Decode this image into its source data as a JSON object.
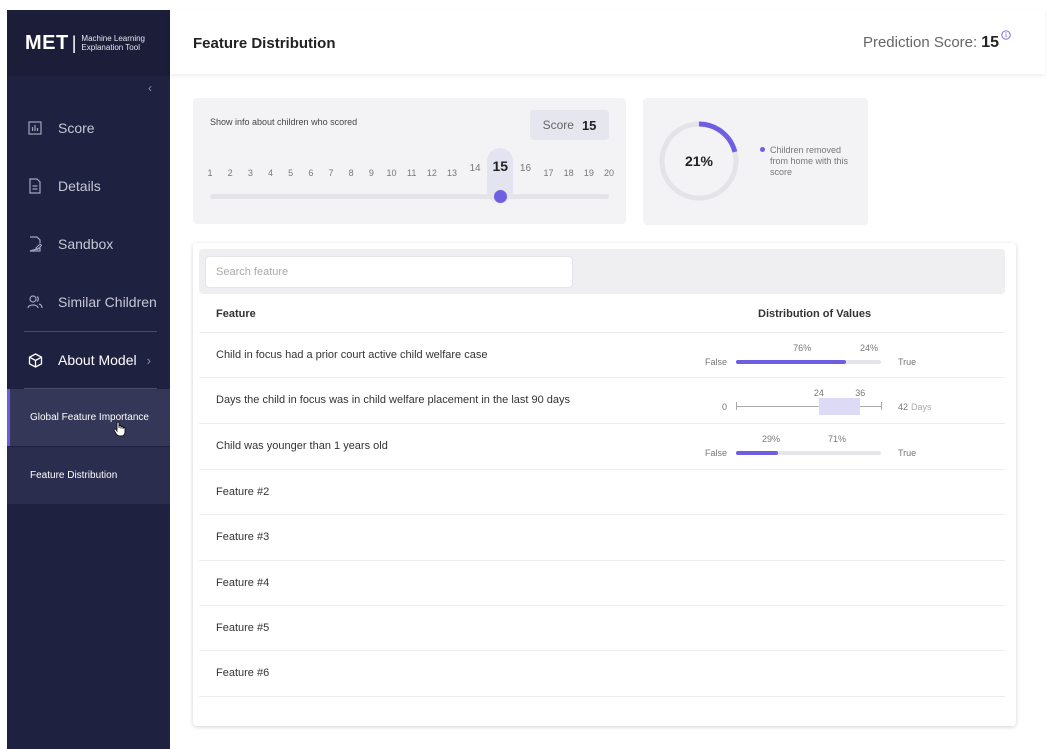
{
  "brand": {
    "name": "MET",
    "subtitle_line1": "Machine Learning",
    "subtitle_line2": "Explanation Tool"
  },
  "sidebar": {
    "collapse_glyph": "‹",
    "items": [
      {
        "label": "Score",
        "icon": "bar-chart-icon"
      },
      {
        "label": "Details",
        "icon": "document-icon"
      },
      {
        "label": "Sandbox",
        "icon": "edit-document-icon"
      },
      {
        "label": "Similar Children",
        "icon": "users-icon"
      },
      {
        "label": "About Model",
        "icon": "cube-icon"
      }
    ],
    "sub_items": [
      {
        "label": "Global Feature Importance"
      },
      {
        "label": "Feature Distribution"
      }
    ]
  },
  "header": {
    "title": "Feature Distribution",
    "prediction_label": "Prediction Score:",
    "prediction_value": "15"
  },
  "score_card": {
    "title": "Show info about children who scored",
    "chip_label": "Score",
    "chip_value": "15",
    "selected": 15,
    "ticks": [
      "1",
      "2",
      "3",
      "4",
      "5",
      "6",
      "7",
      "8",
      "9",
      "10",
      "11",
      "12",
      "13",
      "14",
      "15",
      "16",
      "17",
      "18",
      "19",
      "20"
    ]
  },
  "donut": {
    "percent_label": "21%",
    "fraction": 0.21,
    "legend": "Children removed from home with this score",
    "color": "#6e5fe2"
  },
  "table": {
    "search_placeholder": "Search feature",
    "col_feature": "Feature",
    "col_distribution": "Distribution of Values",
    "rows": [
      {
        "label": "Child in focus had a prior court active child welfare case",
        "type": "bool",
        "left": "False",
        "right": "True",
        "left_pct": "76%",
        "right_pct": "24%",
        "fill": 0.76
      },
      {
        "label": "Days the child in focus was in child welfare placement in the last 90 days",
        "type": "range",
        "min": "0",
        "max": "42",
        "unit": "Days",
        "low": "24",
        "high": "36",
        "min_v": 0,
        "max_v": 42,
        "low_v": 24,
        "high_v": 36
      },
      {
        "label": "Child was younger than 1 years old",
        "type": "bool",
        "left": "False",
        "right": "True",
        "left_pct": "29%",
        "right_pct": "71%",
        "fill": 0.29
      },
      {
        "label": "Feature #2"
      },
      {
        "label": "Feature #3"
      },
      {
        "label": "Feature #4"
      },
      {
        "label": "Feature #5"
      },
      {
        "label": "Feature #6"
      }
    ]
  }
}
